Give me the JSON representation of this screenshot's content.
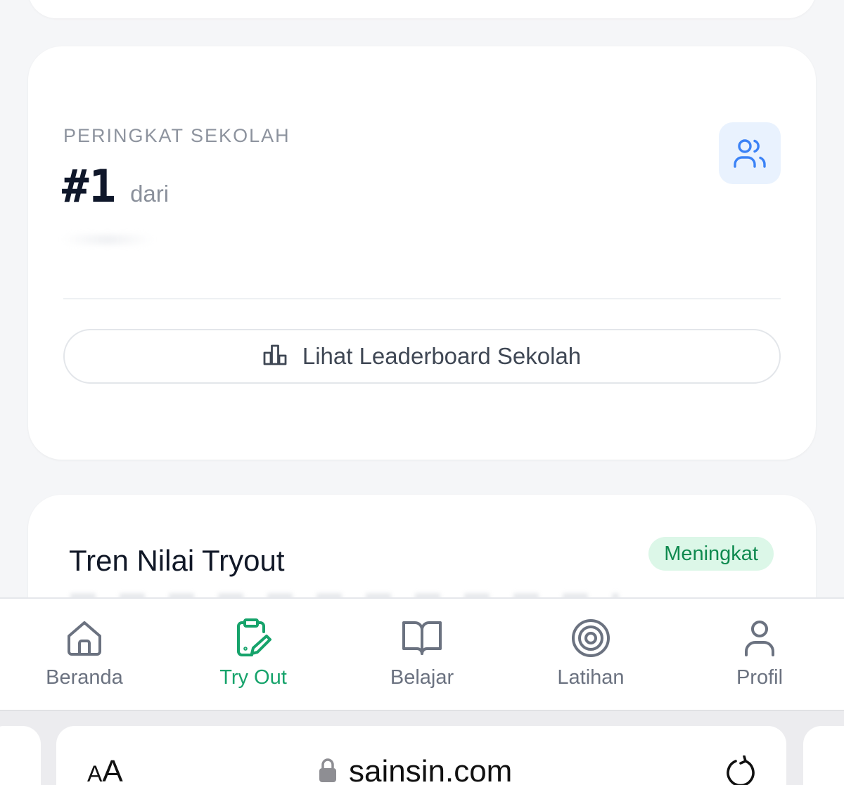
{
  "rank_card": {
    "label": "PERINGKAT SEKOLAH",
    "rank": "#1",
    "rank_suffix": "dari",
    "icon": "users-icon",
    "leaderboard_button": "Lihat Leaderboard Sekolah",
    "leaderboard_icon": "bar-chart-icon"
  },
  "trend_card": {
    "title": "Tren Nilai Tryout",
    "badge": "Meningkat"
  },
  "bottom_nav": {
    "items": [
      {
        "label": "Beranda",
        "icon": "home-icon",
        "active": false
      },
      {
        "label": "Try Out",
        "icon": "clipboard-edit-icon",
        "active": true
      },
      {
        "label": "Belajar",
        "icon": "book-open-icon",
        "active": false
      },
      {
        "label": "Latihan",
        "icon": "target-icon",
        "active": false
      },
      {
        "label": "Profil",
        "icon": "user-icon",
        "active": false
      }
    ]
  },
  "browser": {
    "text_size_label_small": "A",
    "text_size_label_large": "A",
    "url": "sainsin.com"
  },
  "colors": {
    "accent_green": "#16a36b",
    "accent_blue": "#3b82f6",
    "badge_bg": "#dcf7e8",
    "badge_text": "#0f8a4f"
  }
}
